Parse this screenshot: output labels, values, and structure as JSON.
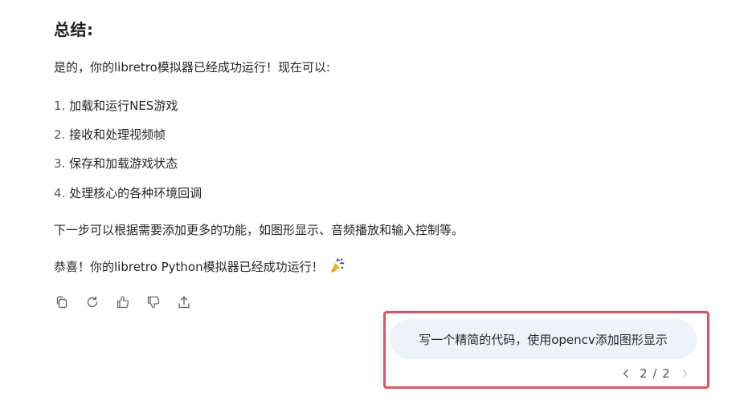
{
  "response": {
    "heading": "总结:",
    "intro": "是的，你的libretro模拟器已经成功运行！现在可以:",
    "list": [
      {
        "num": "1.",
        "text": "加载和运行NES游戏"
      },
      {
        "num": "2.",
        "text": "接收和处理视频帧"
      },
      {
        "num": "3.",
        "text": "保存和加载游戏状态"
      },
      {
        "num": "4.",
        "text": "处理核心的各种环境回调"
      }
    ],
    "next_steps": "下一步可以根据需要添加更多的功能，如图形显示、音频播放和输入控制等。",
    "congrats": "恭喜！你的libretro Python模拟器已经成功运行！",
    "congrats_icon": "party-popper-icon"
  },
  "actions": [
    {
      "name": "copy-button",
      "icon": "copy-icon"
    },
    {
      "name": "regenerate-button",
      "icon": "refresh-icon"
    },
    {
      "name": "like-button",
      "icon": "thumbs-up-icon"
    },
    {
      "name": "dislike-button",
      "icon": "thumbs-down-icon"
    },
    {
      "name": "share-button",
      "icon": "share-icon"
    }
  ],
  "user_message": {
    "text": "写一个精简的代码，使用opencv添加图形显示",
    "pager": "2 / 2"
  },
  "colors": {
    "highlight_border": "#e0545e",
    "bubble_bg": "#eef2fb",
    "icon": "#666666"
  }
}
